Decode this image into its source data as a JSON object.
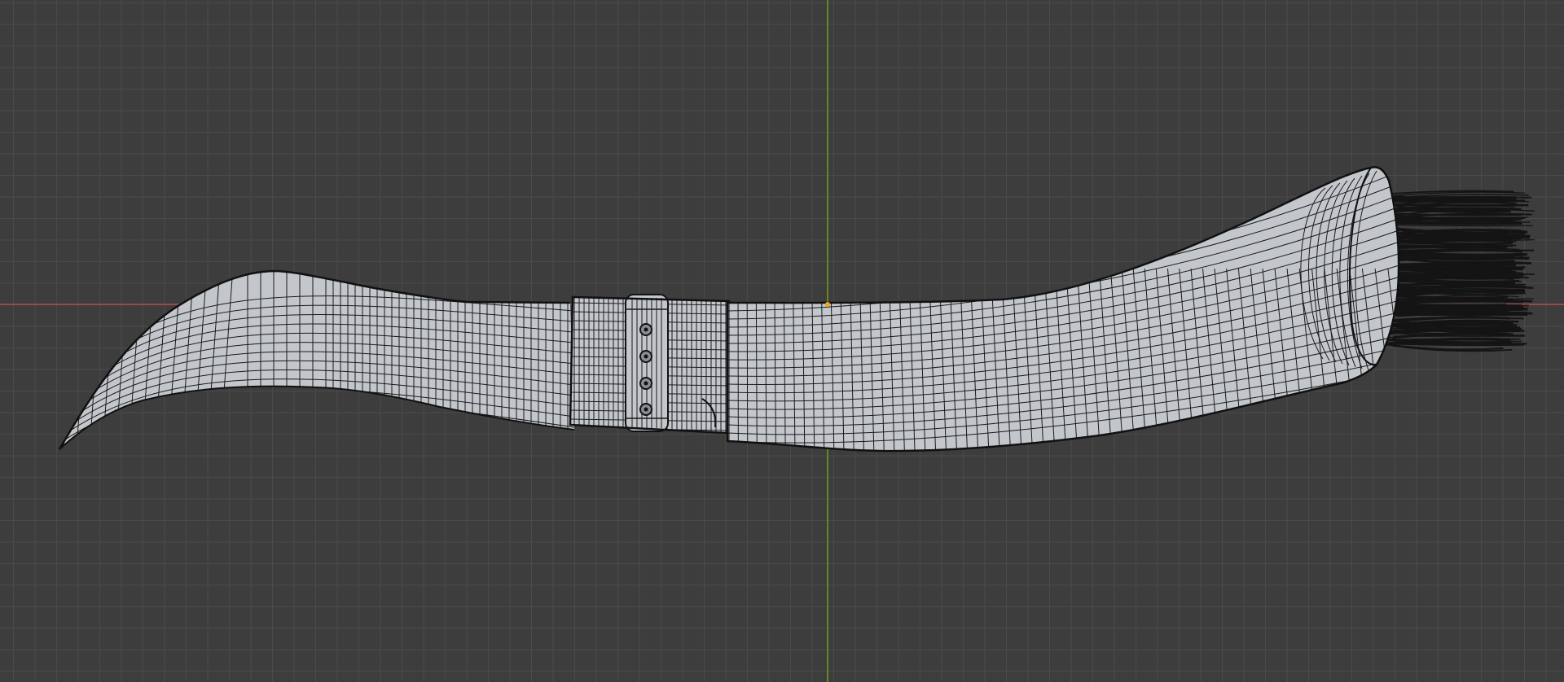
{
  "viewport": {
    "background": "#3d3d3d",
    "grid_color": "#4a4a4a",
    "x_axis_color": "#b04a4e",
    "y_axis_color": "#6b8e23",
    "origin_color": "#f5a623"
  },
  "model": {
    "mesh_fill": "#c3c7cc",
    "wire_color": "#1a1a1a",
    "bristle_color": "#141414",
    "parts": [
      "blade",
      "ferrule",
      "decorative-ring",
      "handle",
      "bristles"
    ]
  }
}
